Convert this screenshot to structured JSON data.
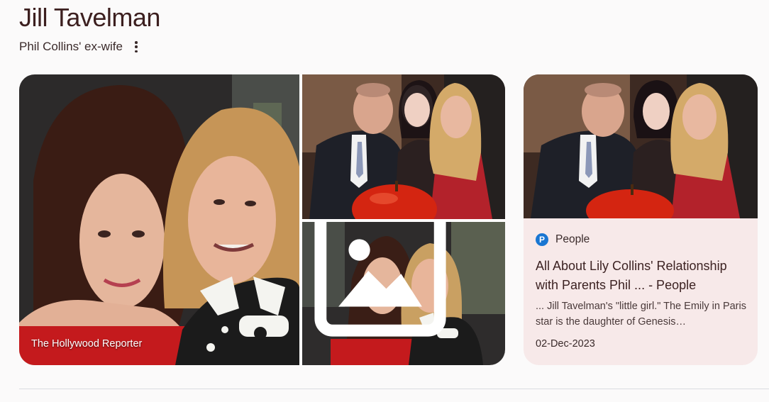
{
  "entity": {
    "title": "Jill Tavelman",
    "subtitle": "Phil Collins' ex-wife"
  },
  "gallery": {
    "main_caption": "The Hollywood Reporter",
    "icons": {
      "more": "more-vert-icon",
      "image": "image-icon"
    }
  },
  "article_card": {
    "source": "People",
    "source_logo_letter": "P",
    "headline": "All About Lily Collins' Relationship with Parents Phil ... - People",
    "snippet": "... Jill Tavelman's \"little girl.\" The Emily in Paris star is the daughter of Genesis…",
    "date": "02-Dec-2023"
  },
  "colors": {
    "background": "#fbfafa",
    "card_background": "#f7e9e9",
    "title": "#3c1f1f",
    "logo_blue": "#1976d2"
  }
}
